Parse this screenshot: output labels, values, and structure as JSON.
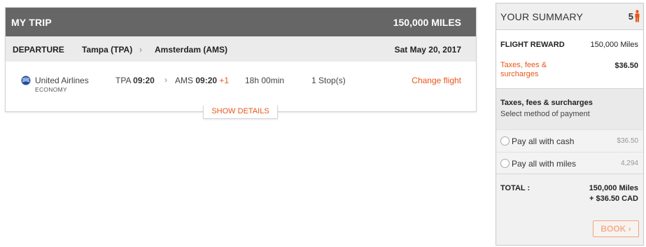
{
  "trip": {
    "title": "MY TRIP",
    "total_miles": "150,000 MILES",
    "departure": {
      "label": "DEPARTURE",
      "from": "Tampa (TPA)",
      "to": "Amsterdam (AMS)",
      "date": "Sat May 20, 2017"
    },
    "flight": {
      "airline": "United Airlines",
      "cabin": "ECONOMY",
      "dep_code": "TPA",
      "dep_time": "09:20",
      "arr_code": "AMS",
      "arr_time": "09:20",
      "day_offset": "+1",
      "duration": "18h 00min",
      "stops": "1 Stop(s)",
      "change_label": "Change flight"
    },
    "show_details_label": "SHOW DETAILS"
  },
  "summary": {
    "title": "YOUR SUMMARY",
    "passengers": "5",
    "flight_reward_label": "FLIGHT REWARD",
    "flight_reward_value": "150,000 Miles",
    "taxes_label": "Taxes, fees & surcharges",
    "taxes_value": "$36.50",
    "payment_title": "Taxes, fees & surcharges",
    "payment_subtitle": "Select method of payment",
    "options": [
      {
        "label": "Pay all with cash",
        "value": "$36.50"
      },
      {
        "label": "Pay all with miles",
        "value": "4,294"
      }
    ],
    "total_label": "TOTAL :",
    "total_miles": "150,000  Miles",
    "total_cash": "+ $36.50  CAD",
    "book_label": "BOOK"
  },
  "colors": {
    "accent": "#e8561a",
    "header_bg": "#666666",
    "airline_blue": "#1f4fa0"
  },
  "icons": [
    "chevron-right-icon",
    "united-airlines-logo",
    "person-icon",
    "radio-icon"
  ]
}
